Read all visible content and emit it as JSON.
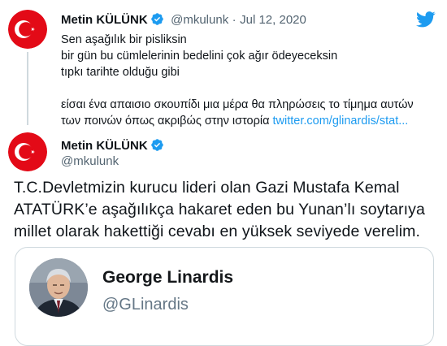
{
  "quoted_tweet": {
    "author_name": "Metin KÜLÜNK",
    "handle": "@mkulunk",
    "separator": "·",
    "date": "Jul 12, 2020",
    "lines": [
      "Sen aşağılık bir pisliksin",
      "bir gün bu cümlelerinin bedelini çok ağır ödeyeceksin",
      "tıpkı tarihte olduğu gibi",
      "",
      "είσαι ένα απαισιο σκουπίδι μια μέρα θα πληρώσεις το τίμημα αυτών",
      "των ποινών όπως ακριβώς στην ιστορία"
    ],
    "link_text": "twitter.com/glinardis/stat..."
  },
  "main_tweet": {
    "author_name": "Metin KÜLÜNK",
    "handle": "@mkulunk",
    "text_lines": [
      "T.C.Devletmizin kurucu lideri olan Gazi Mustafa Kemal",
      "ATATÜRK’e aşağılıkça hakaret eden bu Yunan’lı soytarıya",
      "millet olarak hakettiği cevabı en yüksek seviyede verelim."
    ]
  },
  "embedded_card": {
    "name": "George Linardis",
    "handle": "@GLinardis"
  },
  "icons": {
    "brand": "twitter-bird-icon",
    "verified": "verified-badge-icon"
  },
  "colors": {
    "twitter_blue": "#1d9bf0",
    "flag_red": "#e30a17"
  }
}
